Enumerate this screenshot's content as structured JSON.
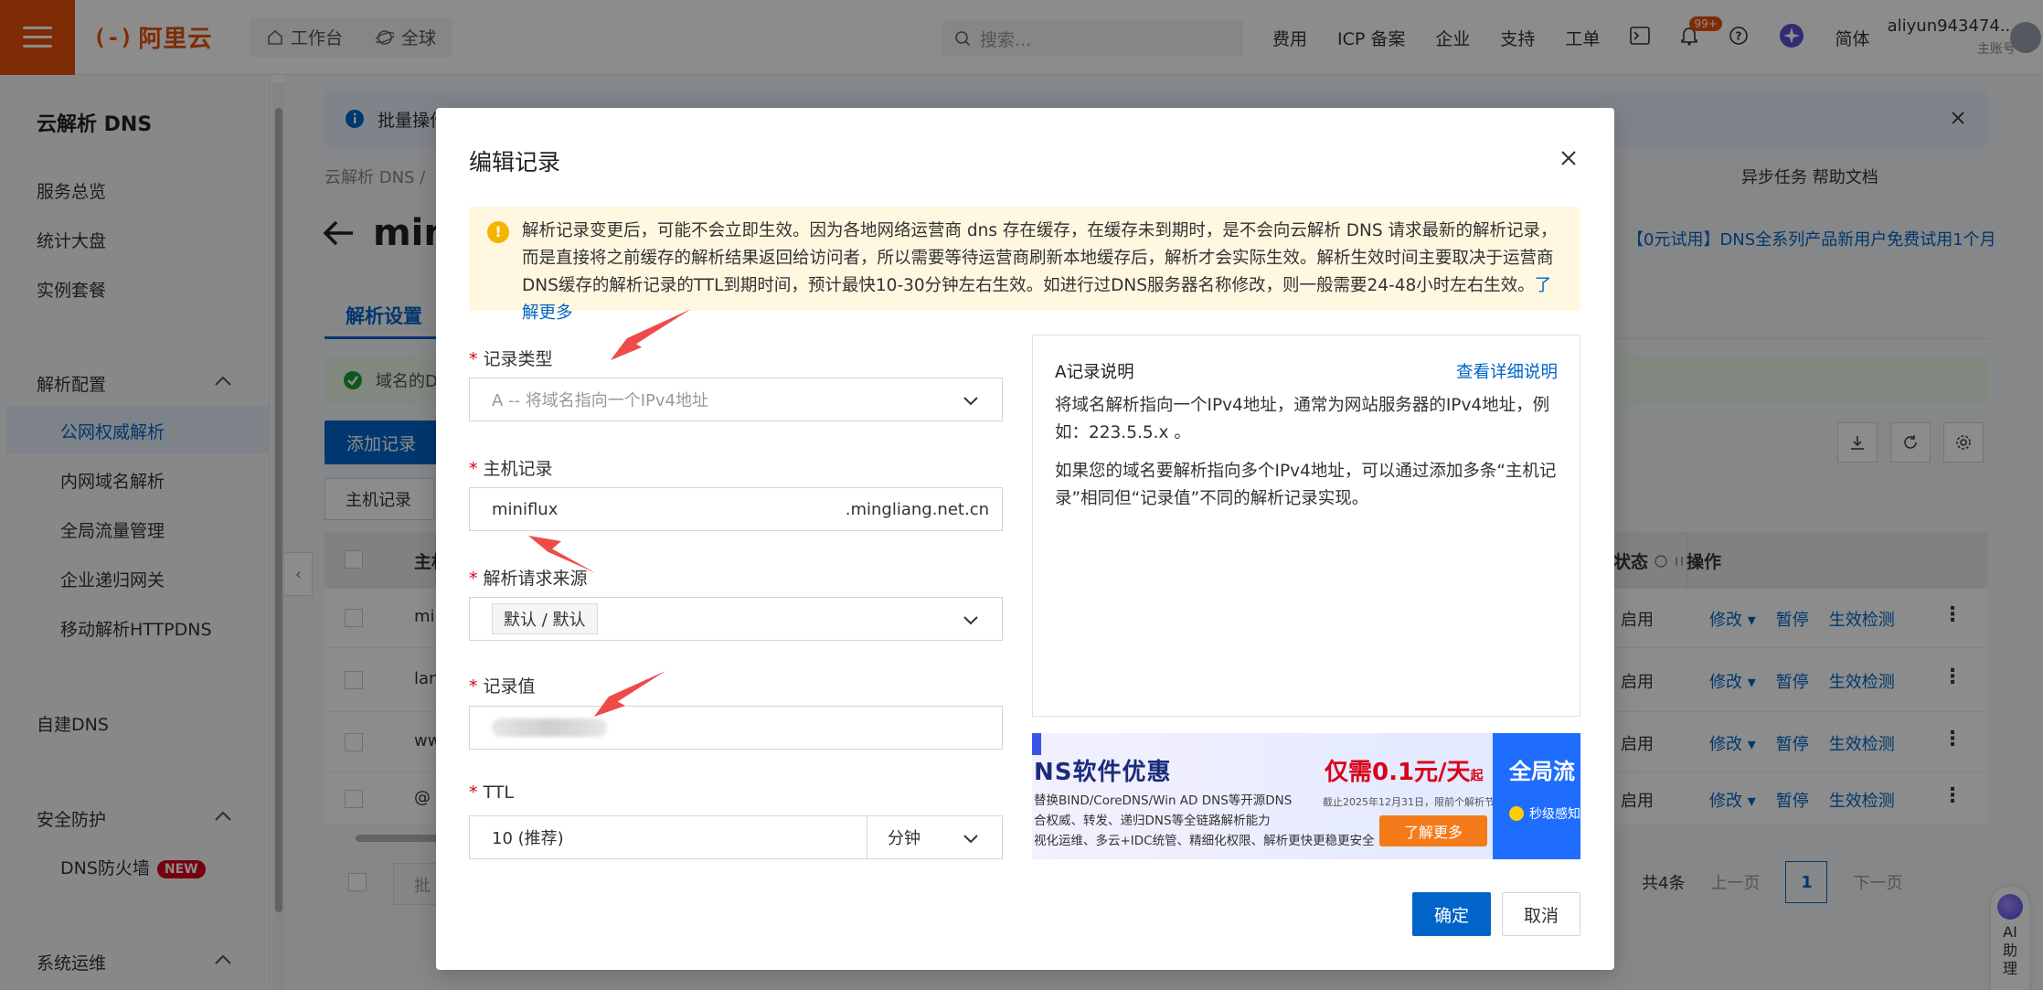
{
  "topbar": {
    "logo_mark": "(-)",
    "logo_text": "阿里云",
    "nav": [
      "工作台",
      "全球"
    ],
    "search_placeholder": "搜索...",
    "right_items": [
      "费用",
      "ICP 备案",
      "企业",
      "支持",
      "工单"
    ],
    "badge": "99+",
    "lang": "简体",
    "user_name": "aliyun943474...",
    "user_sub": "主账号"
  },
  "sidebar": {
    "title": "云解析 DNS",
    "items": [
      "服务总览",
      "统计大盘",
      "实例套餐"
    ],
    "group1": "解析配置",
    "group1_items": [
      "公网权威解析",
      "内网域名解析",
      "全局流量管理",
      "企业递归网关",
      "移动解析HTTPDNS"
    ],
    "item_self": "自建DNS",
    "group2": "安全防护",
    "group2_item": "DNS防火墙",
    "new_tag": "NEW",
    "group3": "系统运维"
  },
  "main": {
    "banner_text": "批量操作",
    "breadcrumb": "云解析 DNS  /",
    "right_links": "异步任务   帮助文档",
    "page_title_prefix": "min",
    "promo": "【0元试用】DNS全系列产品新用户免费试用1个月",
    "tab": "解析设置",
    "success_text": "域名的D",
    "add_button": "添加记录",
    "filter_label": "主机记录",
    "th_host": "主机",
    "th_status": "状态",
    "th_ops": "操作",
    "rows": [
      {
        "host": "mi",
        "status": "启用"
      },
      {
        "host": "lan",
        "status": "启用"
      },
      {
        "host": "ww",
        "status": "启用"
      },
      {
        "host": "@",
        "status": "启用"
      }
    ],
    "ops": [
      "修改 ▾",
      "暂停",
      "生效检测"
    ],
    "batch": "批",
    "pager_total": "共4条",
    "pager_prev": "上一页",
    "pager_cur": "1",
    "pager_next": "下一页",
    "ai": "AI助理"
  },
  "modal": {
    "title": "编辑记录",
    "warning": "解析记录变更后，可能不会立即生效。因为各地网络运营商 dns 存在缓存，在缓存未到期时，是不会向云解析 DNS 请求最新的解析记录，而是直接将之前缓存的解析结果返回给访问者，所以需要等待运营商刷新本地缓存后，解析才会实际生效。解析生效时间主要取决于运营商DNS缓存的解析记录的TTL到期时间，预计最快10-30分钟左右生效。如进行过DNS服务器名称修改，则一般需要24-48小时左右生效。",
    "warning_link": "了解更多",
    "record_type_label": "记录类型",
    "record_type_value": "A -- 将域名指向一个IPv4地址",
    "host_label": "主机记录",
    "host_value": "miniflux",
    "host_suffix": ".mingliang.net.cn",
    "source_label": "解析请求来源",
    "source_value": "默认 / 默认",
    "value_label": "记录值",
    "ttl_label": "TTL",
    "ttl_value": "10 (推荐)",
    "ttl_unit": "分钟",
    "desc_title": "A记录说明",
    "desc_link": "查看详细说明",
    "desc_p1": "将域名解析指向一个IPv4地址，通常为网站服务器的IPv4地址，例如：223.5.5.x 。",
    "desc_p2": "如果您的域名要解析指向多个IPv4地址，可以通过添加多条“主机记录”相同但“记录值”不同的解析记录实现。",
    "ad_head": "NS软件优惠",
    "ad_line1": "替换BIND/CoreDNS/Win AD DNS等开源DNS",
    "ad_line2": "合权威、转发、递归DNS等全链路解析能力",
    "ad_line3": "视化运维、多云+IDC统管、精细化权限、解析更快更稳更安全",
    "ad_price": "仅需0.1元/天",
    "ad_price_suffix": "起",
    "ad_note": "截止2025年12月31日，限前个解析节点",
    "ad_btn": "了解更多",
    "ad_panel_title": "全局流",
    "ad_panel_sub": "秒级感知",
    "ok": "确定",
    "cancel": "取消"
  },
  "colors": {
    "brand": "#e8500c",
    "primary": "#0064c8",
    "warning_bg": "#fff7e0",
    "annotation_arrow": "#f04a4a"
  }
}
